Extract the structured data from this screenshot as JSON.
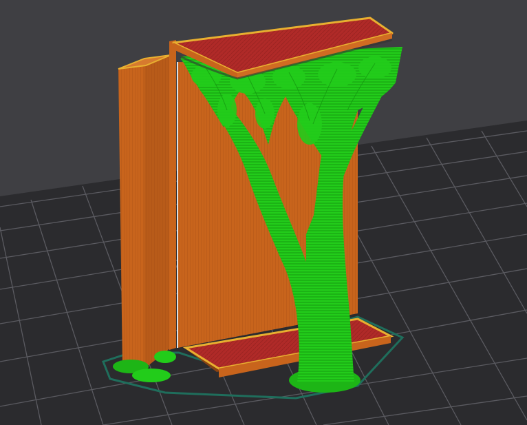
{
  "viewport": {
    "background": "#3f3f43",
    "grid_fill": "#2b2b2e",
    "grid_line": "#5b5b61"
  },
  "colors": {
    "perimeter_orange": "#c8641c",
    "wall_shadow": "#9a4a14",
    "wall_highlight": "#e0e0e0",
    "top_infill_red": "#b02a28",
    "edge_yellow": "#e8b030",
    "support_green": "#22cc1a",
    "support_green_dark": "#159a10",
    "skirt_teal": "#1f6e5c"
  },
  "icons": {
    "scene": "3d-print-preview-icon"
  }
}
